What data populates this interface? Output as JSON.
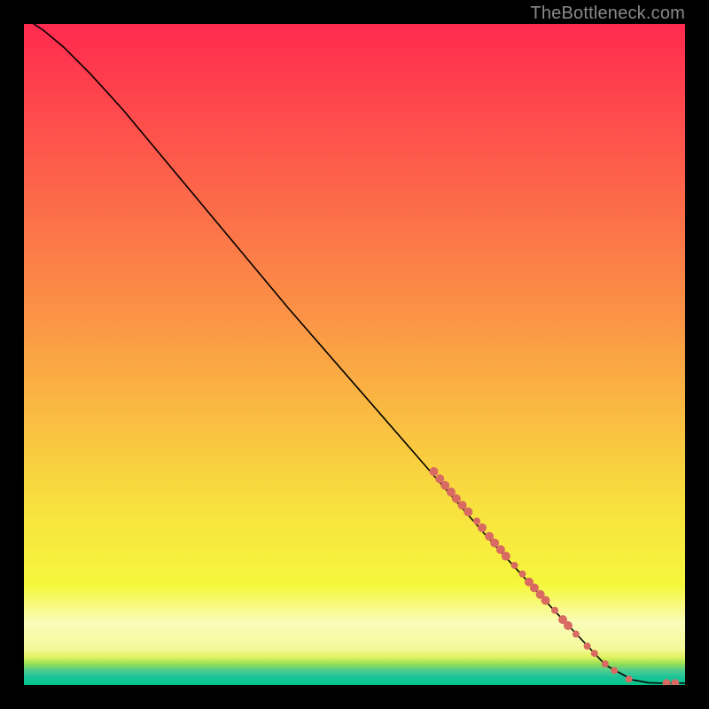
{
  "watermark": "TheBottleneck.com",
  "chart_data": {
    "type": "line",
    "title": "",
    "xlabel": "",
    "ylabel": "",
    "xlim": [
      0,
      100
    ],
    "ylim": [
      0,
      100
    ],
    "grid": false,
    "background_gradient": [
      {
        "offset": 0.0,
        "color": "#ff2a4f"
      },
      {
        "offset": 0.44,
        "color": "#fb9346"
      },
      {
        "offset": 0.73,
        "color": "#f8e13e"
      },
      {
        "offset": 0.85,
        "color": "#f6f73d"
      },
      {
        "offset": 0.905,
        "color": "#fafcb9"
      },
      {
        "offset": 0.945,
        "color": "#f4fa9a"
      },
      {
        "offset": 0.958,
        "color": "#dff25f"
      },
      {
        "offset": 0.968,
        "color": "#95df56"
      },
      {
        "offset": 0.978,
        "color": "#4dcc8e"
      },
      {
        "offset": 0.988,
        "color": "#1bc49a"
      },
      {
        "offset": 1.0,
        "color": "#04c489"
      }
    ],
    "series": [
      {
        "name": "curve",
        "type": "line",
        "color": "#000000",
        "x": [
          0,
          3,
          6,
          10,
          15,
          20,
          30,
          40,
          50,
          60,
          70,
          80,
          88,
          92,
          94.5,
          96,
          97.5,
          99,
          100
        ],
        "y": [
          101,
          99,
          96.5,
          92.5,
          87,
          81,
          69,
          57,
          45.5,
          34,
          22.5,
          11.5,
          3.0,
          0.8,
          0.35,
          0.3,
          0.3,
          0.3,
          0.3
        ]
      },
      {
        "name": "dots",
        "type": "scatter",
        "color": "#d86a62",
        "points": [
          {
            "x": 62.0,
            "y": 32.3,
            "r": 5
          },
          {
            "x": 62.9,
            "y": 31.2,
            "r": 5
          },
          {
            "x": 63.7,
            "y": 30.2,
            "r": 5
          },
          {
            "x": 64.6,
            "y": 29.2,
            "r": 5
          },
          {
            "x": 65.4,
            "y": 28.2,
            "r": 5
          },
          {
            "x": 66.3,
            "y": 27.2,
            "r": 5
          },
          {
            "x": 67.2,
            "y": 26.2,
            "r": 5
          },
          {
            "x": 68.5,
            "y": 24.8,
            "r": 4
          },
          {
            "x": 69.3,
            "y": 23.8,
            "r": 5
          },
          {
            "x": 70.4,
            "y": 22.5,
            "r": 5
          },
          {
            "x": 71.2,
            "y": 21.5,
            "r": 5
          },
          {
            "x": 72.1,
            "y": 20.5,
            "r": 5
          },
          {
            "x": 72.9,
            "y": 19.5,
            "r": 5
          },
          {
            "x": 74.2,
            "y": 18.1,
            "r": 4
          },
          {
            "x": 75.4,
            "y": 16.8,
            "r": 4
          },
          {
            "x": 76.4,
            "y": 15.6,
            "r": 5
          },
          {
            "x": 77.2,
            "y": 14.7,
            "r": 5
          },
          {
            "x": 78.1,
            "y": 13.7,
            "r": 5
          },
          {
            "x": 78.9,
            "y": 12.8,
            "r": 5
          },
          {
            "x": 80.3,
            "y": 11.3,
            "r": 4
          },
          {
            "x": 81.5,
            "y": 9.9,
            "r": 5
          },
          {
            "x": 82.3,
            "y": 9.0,
            "r": 5
          },
          {
            "x": 83.5,
            "y": 7.7,
            "r": 4
          },
          {
            "x": 85.2,
            "y": 5.9,
            "r": 4
          },
          {
            "x": 86.3,
            "y": 4.8,
            "r": 4
          },
          {
            "x": 87.9,
            "y": 3.2,
            "r": 4
          },
          {
            "x": 89.3,
            "y": 2.2,
            "r": 4
          },
          {
            "x": 91.5,
            "y": 0.9,
            "r": 4
          },
          {
            "x": 97.2,
            "y": 0.3,
            "r": 4.5
          },
          {
            "x": 98.5,
            "y": 0.3,
            "r": 4.5
          }
        ]
      }
    ]
  }
}
